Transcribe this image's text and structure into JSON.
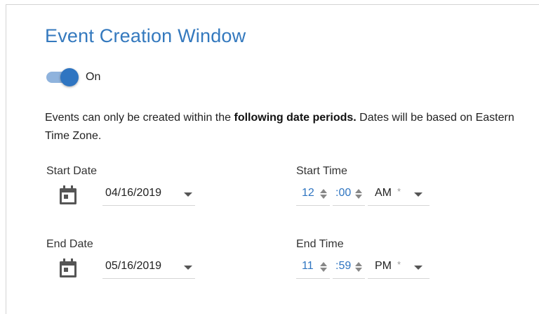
{
  "title": "Event Creation Window",
  "toggle": {
    "state_label": "On",
    "enabled": true
  },
  "description": {
    "before": "Events can only be created within the ",
    "bold": "following date periods.",
    "after": " Dates will be based on Eastern Time Zone."
  },
  "start": {
    "date_label": "Start Date",
    "date_value": "04/16/2019",
    "time_label": "Start Time",
    "hour": "12",
    "minute": ":00",
    "meridiem": "AM",
    "required_mark": "*"
  },
  "end": {
    "date_label": "End Date",
    "date_value": "05/16/2019",
    "time_label": "End Time",
    "hour": "11",
    "minute": ":59",
    "meridiem": "PM",
    "required_mark": "*"
  },
  "colors": {
    "accent": "#2f75c1",
    "title": "#3479be",
    "track": "#8fb3dd"
  }
}
